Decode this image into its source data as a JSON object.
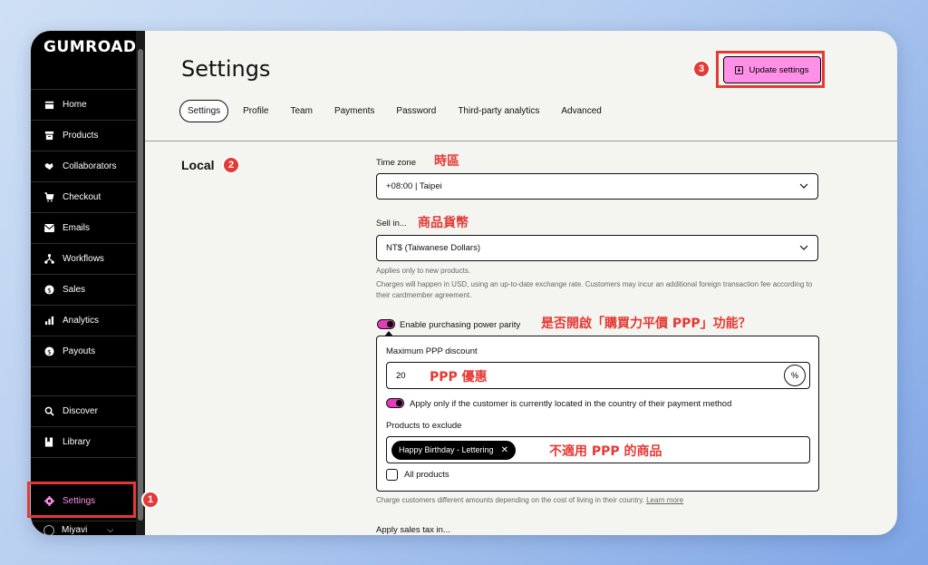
{
  "sidebar": {
    "logo": "GUMROAD",
    "items": [
      {
        "label": "Home",
        "icon": "home-icon"
      },
      {
        "label": "Products",
        "icon": "archive-icon"
      },
      {
        "label": "Collaborators",
        "icon": "handshake-icon"
      },
      {
        "label": "Checkout",
        "icon": "cart-icon"
      },
      {
        "label": "Emails",
        "icon": "envelope-icon"
      },
      {
        "label": "Workflows",
        "icon": "workflow-icon"
      },
      {
        "label": "Sales",
        "icon": "dollar-icon"
      },
      {
        "label": "Analytics",
        "icon": "bar-chart-icon"
      },
      {
        "label": "Payouts",
        "icon": "payout-icon"
      },
      {
        "label": "Discover",
        "icon": "search-icon"
      },
      {
        "label": "Library",
        "icon": "bookmark-icon"
      },
      {
        "label": "Settings",
        "icon": "gear-icon"
      }
    ],
    "user": "Miyavi"
  },
  "header": {
    "title": "Settings",
    "update_button": "Update settings"
  },
  "tabs": [
    "Settings",
    "Profile",
    "Team",
    "Payments",
    "Password",
    "Third-party analytics",
    "Advanced"
  ],
  "local": {
    "section_title": "Local",
    "time_zone_label": "Time zone",
    "time_zone_value": "+08:00 | Taipei",
    "sell_in_label": "Sell in...",
    "sell_in_value": "NT$ (Taiwanese Dollars)",
    "help_new_products": "Applies only to new products.",
    "help_usd": "Charges will happen in USD, using an up-to-date exchange rate. Customers may incur an additional foreign transaction fee according to their cardmember agreement.",
    "ppp_toggle_label": "Enable purchasing power parity",
    "max_ppp_label": "Maximum PPP discount",
    "max_ppp_value": "20",
    "percent_symbol": "%",
    "apply_location_label": "Apply only if the customer is currently located in the country of their payment method",
    "exclude_label": "Products to exclude",
    "excluded_product": "Happy Birthday - Lettering",
    "all_products_label": "All products",
    "ppp_help": "Charge customers different amounts depending on the cost of living in their country.",
    "learn_more": "Learn more",
    "sales_tax_label": "Apply sales tax in..."
  },
  "annotations": {
    "time_zone": "時區",
    "currency": "商品貨幣",
    "ppp_question": "是否開啟「購買力平價 PPP」功能？",
    "ppp_discount": "PPP 優惠",
    "excluded": "不適用 PPP 的商品",
    "badge1": "1",
    "badge2": "2",
    "badge3": "3"
  },
  "colors": {
    "accent_pink": "#ff90e8",
    "toggle_pink": "#e23cb9",
    "annotation_red": "#e53935"
  }
}
